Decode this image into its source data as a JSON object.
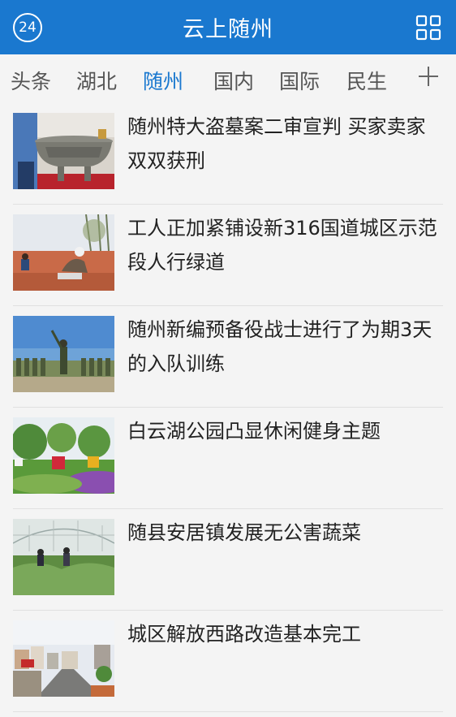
{
  "header": {
    "logo_text": "24",
    "title": "云上随州",
    "menu_icon": "grid-icon"
  },
  "tabs": [
    {
      "label": "头条",
      "active": false
    },
    {
      "label": "湖北",
      "active": false
    },
    {
      "label": "随州",
      "active": true
    },
    {
      "label": "国内",
      "active": false
    },
    {
      "label": "国际",
      "active": false
    },
    {
      "label": "民生",
      "active": false
    }
  ],
  "add_tab_icon": "plus-icon",
  "colors": {
    "brand": "#1a78cf",
    "background": "#f4f4f4",
    "text": "#222222",
    "tab_text": "#555555"
  },
  "news": [
    {
      "title": "随州特大盗墓案二审宣判 买家卖家双双获刑",
      "image": "bronze-artifact-photo"
    },
    {
      "title": "工人正加紧铺设新316国道城区示范段人行绿道",
      "image": "road-workers-photo"
    },
    {
      "title": "随州新编预备役战士进行了为期3天的入队训练",
      "image": "soldiers-training-photo"
    },
    {
      "title": "白云湖公园凸显休闲健身主题",
      "image": "park-flowers-photo"
    },
    {
      "title": "随县安居镇发展无公害蔬菜",
      "image": "greenhouse-vegetables-photo"
    },
    {
      "title": "城区解放西路改造基本完工",
      "image": "city-street-photo"
    }
  ]
}
